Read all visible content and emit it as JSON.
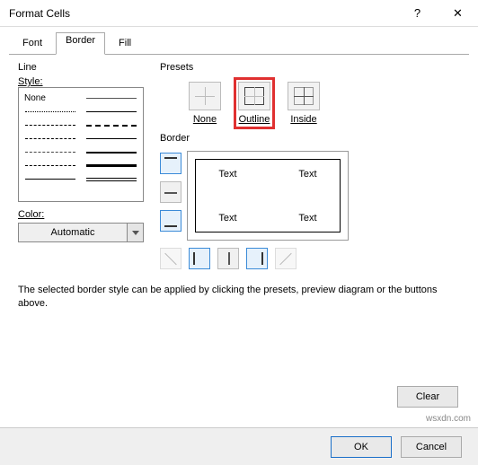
{
  "window": {
    "title": "Format Cells",
    "help": "?",
    "close": "✕"
  },
  "tabs": {
    "font": "Font",
    "border": "Border",
    "fill": "Fill",
    "active": "Border"
  },
  "line": {
    "group": "Line",
    "style_label": "Style:",
    "none": "None",
    "color_label": "Color:",
    "color_value": "Automatic"
  },
  "presets": {
    "group": "Presets",
    "none": "None",
    "outline": "Outline",
    "inside": "Inside"
  },
  "border": {
    "group": "Border",
    "cell": "Text"
  },
  "description": "The selected border style can be applied by clicking the presets, preview diagram or the buttons above.",
  "buttons": {
    "clear": "Clear",
    "ok": "OK",
    "cancel": "Cancel"
  },
  "watermark": "wsxdn.com",
  "highlight": {
    "tab": "border",
    "preset": "outline"
  }
}
